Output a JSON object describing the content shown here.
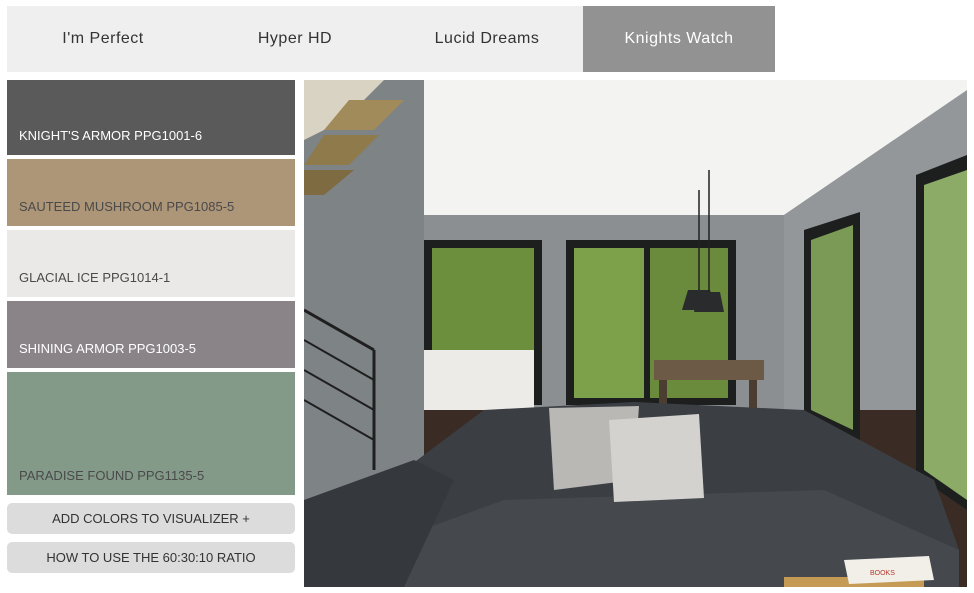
{
  "tabs": [
    {
      "label": "I'm Perfect",
      "active": false
    },
    {
      "label": "Hyper HD",
      "active": false
    },
    {
      "label": "Lucid Dreams",
      "active": false
    },
    {
      "label": "Knights Watch",
      "active": true
    }
  ],
  "swatches": [
    {
      "label": "KNIGHT'S ARMOR PPG1001-6",
      "color": "#5a5a5b"
    },
    {
      "label": "SAUTEED MUSHROOM PPG1085-5",
      "color": "#ad9577"
    },
    {
      "label": "GLACIAL ICE PPG1014-1",
      "color": "#ebe9e8"
    },
    {
      "label": "SHINING ARMOR PPG1003-5",
      "color": "#8a8489"
    },
    {
      "label": "PARADISE FOUND PPG1135-5",
      "color": "#849a89"
    }
  ],
  "buttons": {
    "add_colors": "ADD COLORS TO VISUALIZER +",
    "ratio": "HOW TO USE THE 60:30:10 RATIO"
  },
  "room_image": {
    "book_text": "BOOKS"
  }
}
